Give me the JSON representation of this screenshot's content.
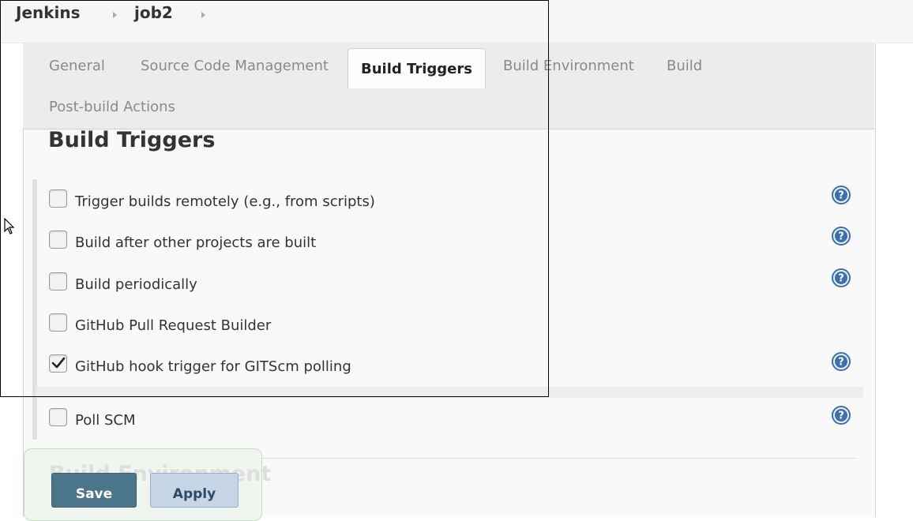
{
  "breadcrumb": {
    "items": [
      "Jenkins",
      "job2"
    ]
  },
  "tabs": {
    "general": "General",
    "scm": "Source Code Management",
    "build_triggers": "Build Triggers",
    "build_environment": "Build Environment",
    "build": "Build",
    "post_build": "Post-build Actions",
    "active": "Build Triggers"
  },
  "section": {
    "title": "Build Triggers",
    "next_title": "Build Environment"
  },
  "triggers": [
    {
      "label": "Trigger builds remotely (e.g., from scripts)",
      "checked": false,
      "help": true
    },
    {
      "label": "Build after other projects are built",
      "checked": false,
      "help": true
    },
    {
      "label": "Build periodically",
      "checked": false,
      "help": true
    },
    {
      "label": "GitHub Pull Request Builder",
      "checked": false,
      "help": false
    },
    {
      "label": "GitHub hook trigger for GITScm polling",
      "checked": true,
      "help": true
    },
    {
      "label": "Poll SCM",
      "checked": false,
      "help": true
    }
  ],
  "buttons": {
    "save": "Save",
    "apply": "Apply"
  },
  "colors": {
    "save_button": "#4b758b",
    "apply_button": "#c7d6e6",
    "help_icon": "#3b6fb0"
  },
  "icons": {
    "help": "question-circle-icon",
    "check": "checkmark-icon",
    "cursor": "mouse-pointer-icon",
    "separator": "triangle-right-icon"
  }
}
